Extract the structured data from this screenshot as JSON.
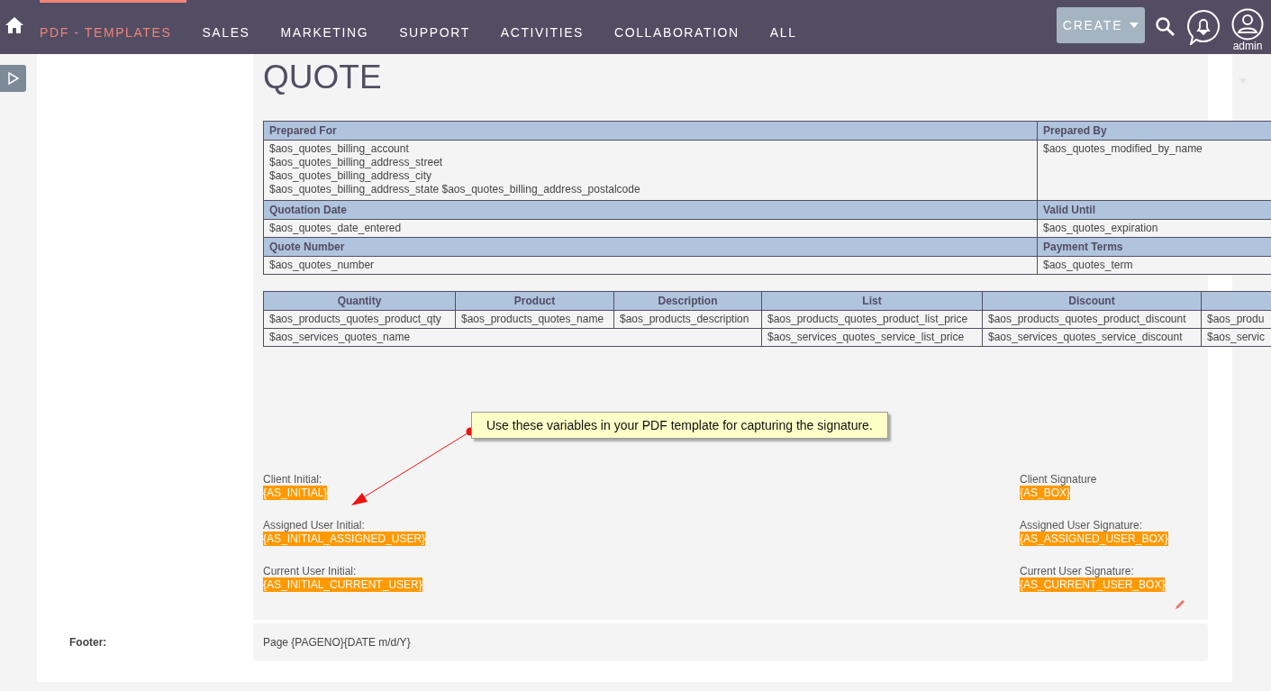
{
  "nav": {
    "tabs": [
      {
        "label": "PDF - TEMPLATES",
        "selected": true
      },
      {
        "label": "SALES",
        "selected": false
      },
      {
        "label": "MARKETING",
        "selected": false
      },
      {
        "label": "SUPPORT",
        "selected": false
      },
      {
        "label": "ACTIVITIES",
        "selected": false
      },
      {
        "label": "COLLABORATION",
        "selected": false
      },
      {
        "label": "ALL",
        "selected": false
      }
    ],
    "create_button": "CREATE",
    "user": "admin"
  },
  "document": {
    "title": "QUOTE",
    "info_table": [
      {
        "left_header": "Prepared For",
        "right_header": "Prepared By",
        "left": [
          "$aos_quotes_billing_account",
          "$aos_quotes_billing_address_street",
          "$aos_quotes_billing_address_city",
          "$aos_quotes_billing_address_state $aos_quotes_billing_address_postalcode"
        ],
        "right": [
          "$aos_quotes_modified_by_name"
        ]
      },
      {
        "left_header": "Quotation Date",
        "right_header": "Valid Until",
        "left": [
          "$aos_quotes_date_entered"
        ],
        "right": [
          "$aos_quotes_expiration"
        ]
      },
      {
        "left_header": "Quote Number",
        "right_header": "Payment Terms",
        "left": [
          "$aos_quotes_number"
        ],
        "right": [
          "$aos_quotes_term"
        ]
      }
    ],
    "line_items": {
      "columns": [
        "Quantity",
        "Product",
        "Description",
        "List",
        "Discount"
      ],
      "product_row": [
        "$aos_products_quotes_product_qty",
        "$aos_products_quotes_name",
        "$aos_products_description",
        "$aos_products_quotes_product_list_price",
        "$aos_products_quotes_product_discount",
        "$aos_produ"
      ],
      "service_row": [
        "$aos_services_quotes_name",
        "$aos_services_quotes_service_list_price",
        "$aos_services_quotes_service_discount",
        "$aos_servic"
      ]
    },
    "tooltip": "Use these variables in your PDF template for capturing the signature.",
    "signatures": [
      {
        "left_label": "Client Initial:",
        "left_var": "{AS_INITIAL}",
        "right_label": "Client Signature",
        "right_var": "{AS_BOX}"
      },
      {
        "left_label": "Assigned User Initial:",
        "left_var": "{AS_INITIAL_ASSIGNED_USER}",
        "right_label": "Assigned User Signature:",
        "right_var": "{AS_ASSIGNED_USER_BOX}"
      },
      {
        "left_label": "Current User Initial:",
        "left_var": "{AS_INITIAL_CURRENT_USER}",
        "right_label": "Current User Signature:",
        "right_var": "{AS_CURRENT_USER_BOX}"
      }
    ]
  },
  "footer": {
    "label": "Footer:",
    "value": "Page {PAGENO}{DATE m/d/Y}"
  }
}
